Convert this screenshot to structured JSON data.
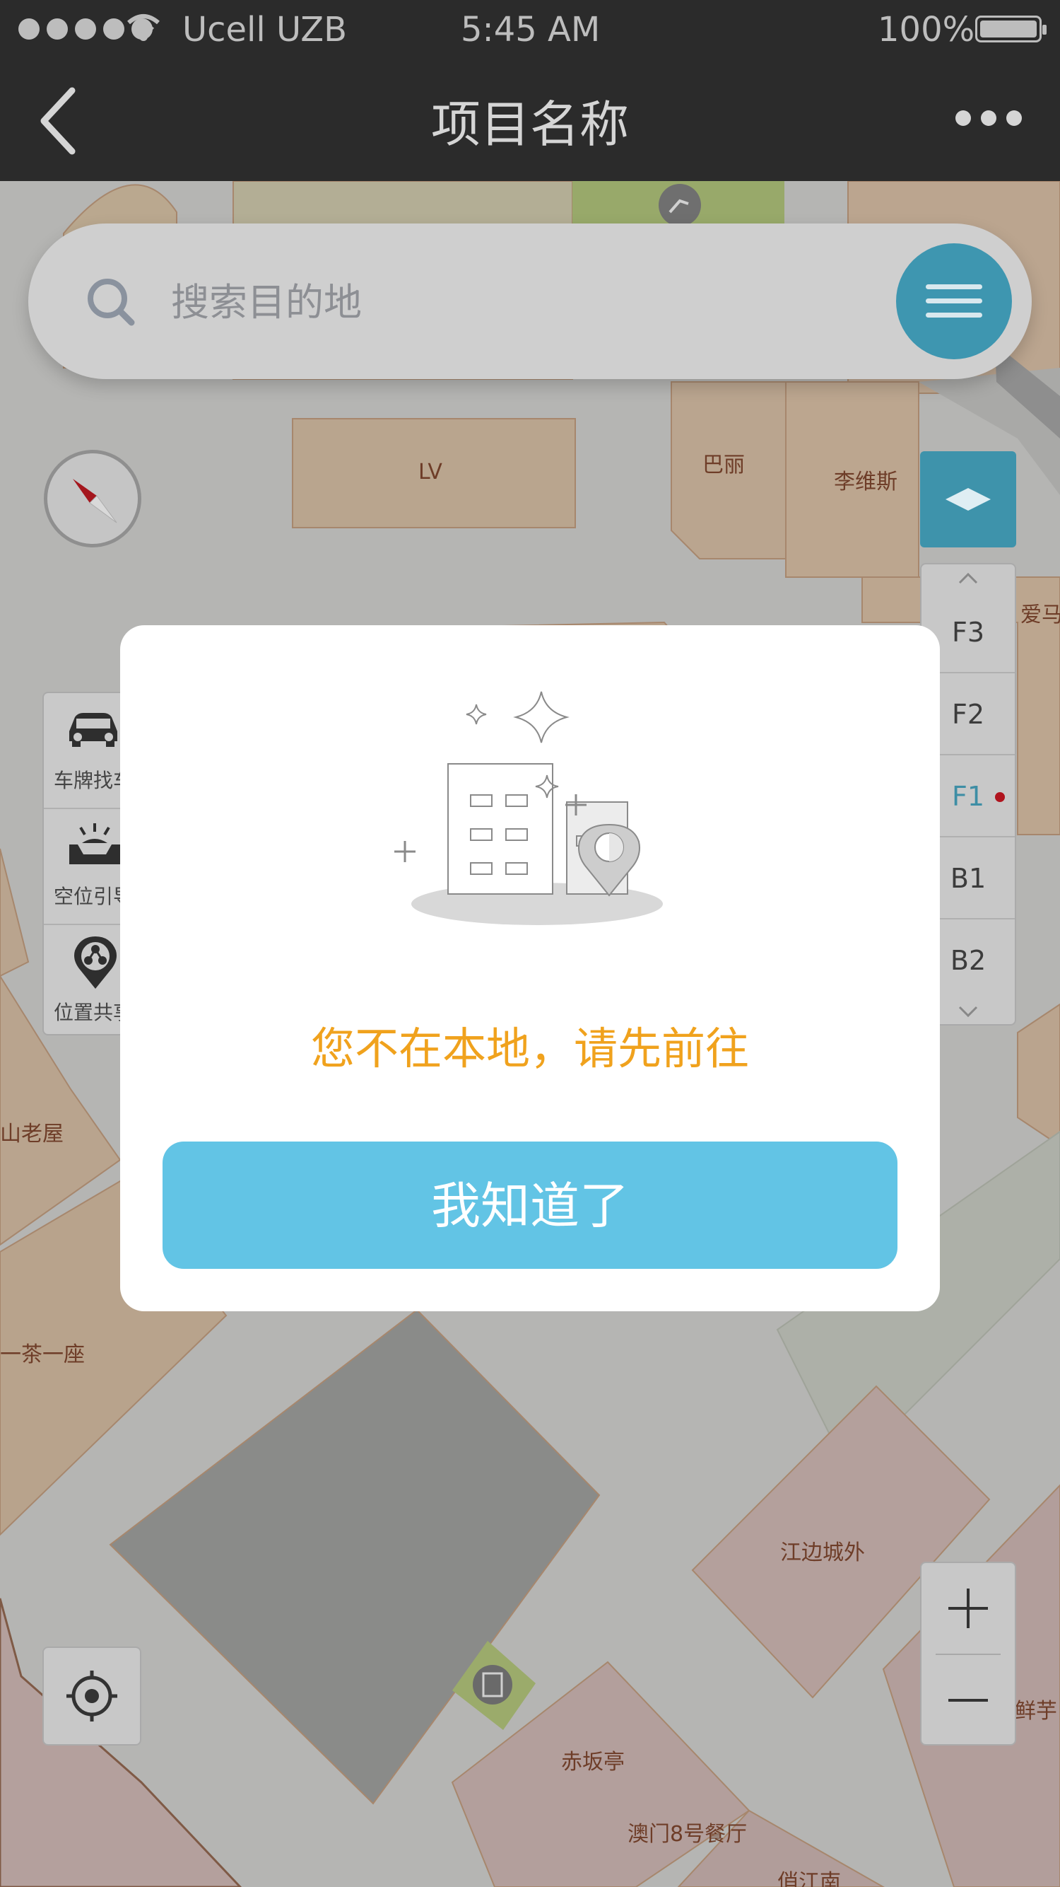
{
  "status_bar": {
    "carrier": "Ucell UZB",
    "time": "5:45 AM",
    "battery": "100%"
  },
  "nav": {
    "title": "项目名称"
  },
  "search": {
    "placeholder": "搜索目的地"
  },
  "map": {
    "labels": {
      "lv": "LV",
      "bali": "巴丽",
      "liweisi": "李维斯",
      "aima": "爱马",
      "shanlaowu": "山老屋",
      "yichayizuo": "一茶一座",
      "jiangbian": "江边城外",
      "chibanting": "赤坂亭",
      "aomen": "澳门8号餐厅",
      "qiaojiangnan": "俏江南",
      "xianyu": "鲜芋"
    }
  },
  "tools": [
    {
      "label": "车牌找车",
      "icon": "car-icon"
    },
    {
      "label": "空位引导",
      "icon": "parking-space-icon"
    },
    {
      "label": "位置共享",
      "icon": "location-share-icon"
    }
  ],
  "floors": [
    "F3",
    "F2",
    "F1",
    "B1",
    "B2"
  ],
  "active_floor": "F1",
  "dialog": {
    "message": "您不在本地，请先前往",
    "button": "我知道了"
  },
  "colors": {
    "accent_blue": "#62c4e5",
    "warning_orange": "#f0a21d",
    "active_floor_dot": "#b0141e"
  }
}
